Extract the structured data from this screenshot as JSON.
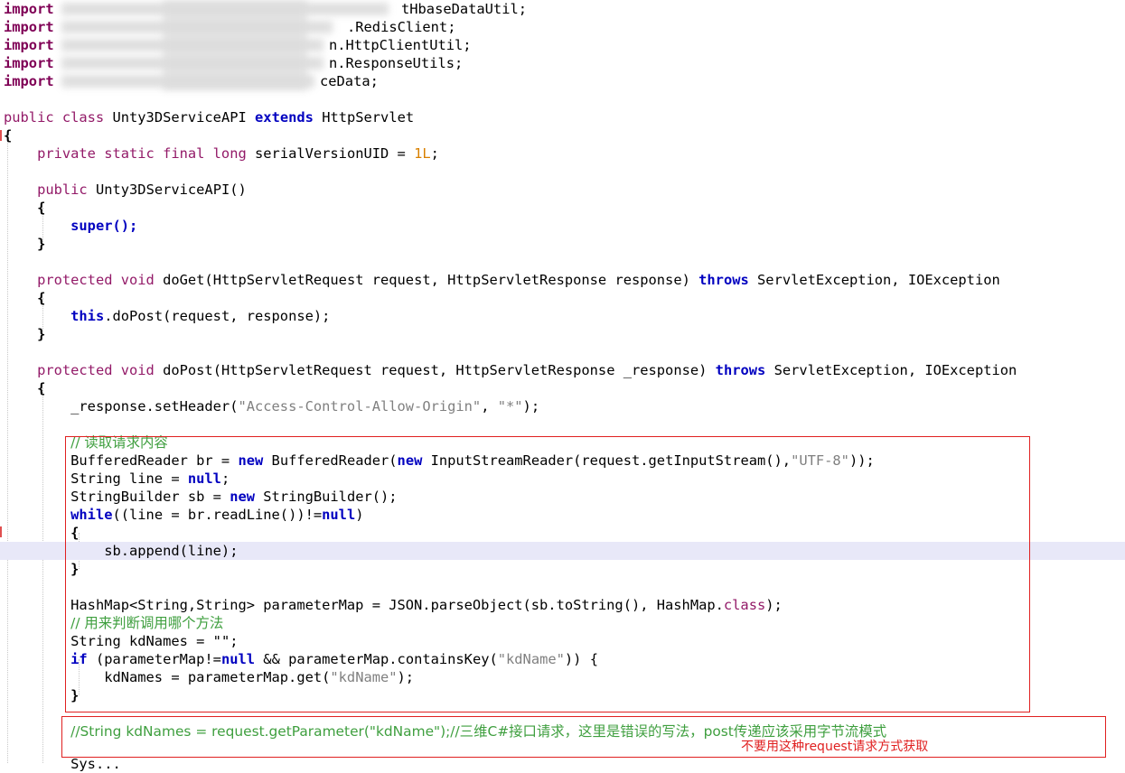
{
  "code": {
    "imports": [
      {
        "kw": "import",
        "visible_tail": "tHbaseDataUtil;"
      },
      {
        "kw": "import",
        "visible_tail": ".RedisClient;"
      },
      {
        "kw": "import",
        "visible_tail": "n.HttpClientUtil;"
      },
      {
        "kw": "import",
        "visible_tail": "n.ResponseUtils;"
      },
      {
        "kw": "import",
        "visible_tail": "ceData;"
      }
    ],
    "class_decl": {
      "mods": "public class",
      "name": "Unty3DServiceAPI",
      "extends_kw": "extends",
      "super_class": "HttpServlet"
    },
    "serial_field": {
      "mods": "private static final long",
      "name": "serialVersionUID",
      "value": "1L"
    },
    "constructor": {
      "mods": "public",
      "name": "Unty3DServiceAPI()",
      "body": "super();"
    },
    "do_get": {
      "mods": "protected void",
      "signature": "doGet(HttpServletRequest request, HttpServletResponse response)",
      "throws_kw": "throws",
      "exceptions": "ServletException, IOException",
      "body_kw": "this",
      "body_rest": ".doPost(request, response);"
    },
    "do_post": {
      "mods": "protected void",
      "signature": "doPost(HttpServletRequest request, HttpServletResponse _response)",
      "throws_kw": "throws",
      "exceptions": "ServletException, IOException"
    },
    "set_header": {
      "pre": "_response.setHeader(",
      "arg1": "\"Access-Control-Allow-Origin\"",
      "sep": ", ",
      "arg2": "\"*\"",
      "post": ");"
    },
    "comment_read": "// 读取请求内容",
    "comment_decide": "// 用来判断调用哪个方法",
    "wrong_line": "//String kdNames = request.getParameter(\"kdName\");//三维C#接口请求，这里是错误的写法，post传递应该采用字节流模式",
    "annotation": "不要用这种request请求方式获取",
    "strings": {
      "utf8": "\"UTF-8\"",
      "empty": "\"\"",
      "kdName": "\"kdName\""
    },
    "tokens": {
      "brace_open": "{",
      "brace_close": "}",
      "new": "new",
      "null": "null",
      "while": "while",
      "if": "if",
      "class": "class",
      "br_pre": "BufferedReader br = ",
      "br_mid": " BufferedReader(",
      "br_mid2": " InputStreamReader(request.getInputStream(),",
      "br_end": "));",
      "line_decl": "String line = ",
      "semi": ";",
      "sb_pre": "StringBuilder sb = ",
      "sb_post": " StringBuilder();",
      "while_mid": "((line = br.readLine())!=",
      "paren_close": ")",
      "sb_append": "sb.append(line);",
      "map_line_pre": "HashMap<String,String> parameterMap = JSON.parseObject(sb.toString(), HashMap.",
      "map_line_post": ");",
      "kd_decl": "String kdNames = ",
      "if_mid": " (parameterMap!=",
      "if_and": " && parameterMap.containsKey(",
      "if_end": ")) {",
      "kd_assign": "kdNames = parameterMap.get(",
      "kd_assign_end": ");",
      "tail_line": "Sys..."
    }
  }
}
